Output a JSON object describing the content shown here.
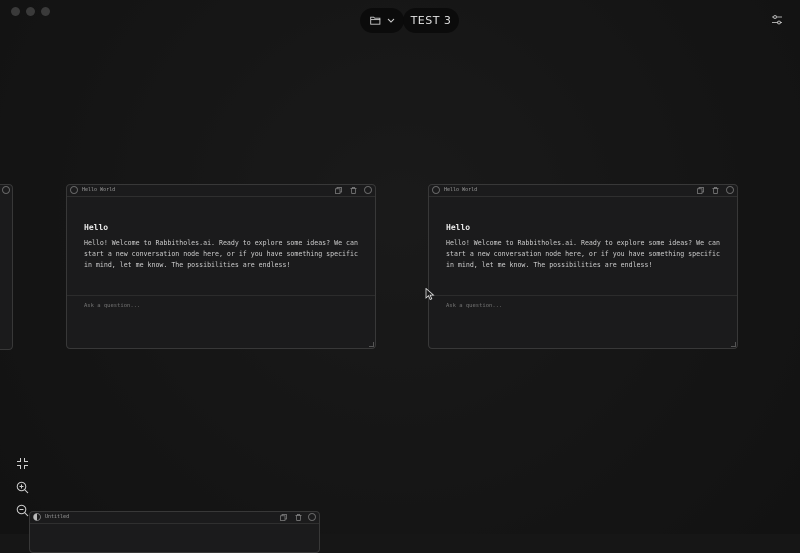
{
  "window": {
    "title": "TEST 3"
  },
  "toolbar": {
    "folder_icon": "folder-icon",
    "chevron_icon": "chevron-down-icon",
    "settings_icon": "sliders-icon"
  },
  "nodes": [
    {
      "title": "Hello World",
      "heading": "Hello",
      "body": "Hello! Welcome to Rabbitholes.ai. Ready to explore some ideas? We can start a new conversation node here, or if you have something specific in mind, let me know. The possibilities are endless!",
      "input_placeholder": "Ask a question..."
    },
    {
      "title": "Hello World",
      "heading": "Hello",
      "body": "Hello! Welcome to Rabbitholes.ai. Ready to explore some ideas? We can start a new conversation node here, or if you have something specific in mind, let me know. The possibilities are endless!",
      "input_placeholder": "Ask a question..."
    },
    {
      "title": "Untitled"
    }
  ],
  "controls": {
    "collapse_icon": "minimize-icon",
    "zoom_in_icon": "zoom-in-icon",
    "zoom_out_icon": "zoom-out-icon"
  },
  "colors": {
    "background": "#161616",
    "card": "#1b1b1c",
    "pill": "#0b0b0b",
    "border": "#383838"
  }
}
